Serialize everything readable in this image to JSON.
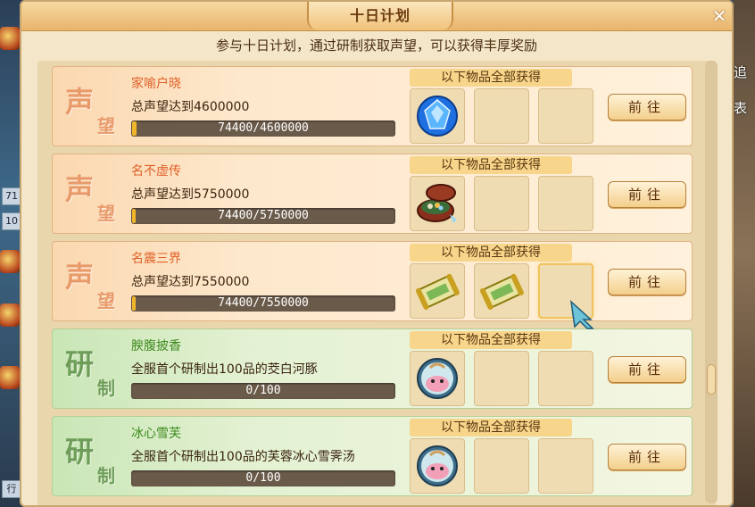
{
  "window": {
    "title": "十日计划",
    "close_glyph": "✕"
  },
  "subtitle": "参与十日计划，通过研制获取声望，可以获得丰厚奖励",
  "reward_header": "以下物品全部获得",
  "go_label": "前往",
  "background": {
    "left_chips": [
      "71",
      "10"
    ],
    "left_bottom": "行",
    "right_texts": [
      "追",
      "表"
    ]
  },
  "rows": [
    {
      "type": "fame",
      "badge": [
        "声",
        "望"
      ],
      "name": "家喻户晓",
      "desc": "总声望达到4600000",
      "progress_text": "74400/4600000",
      "progress": 0.0162,
      "rewards": [
        "blue-gem-icon",
        "",
        ""
      ]
    },
    {
      "type": "fame",
      "badge": [
        "声",
        "望"
      ],
      "name": "名不虚传",
      "desc": "总声望达到5750000",
      "progress_text": "74400/5750000",
      "progress": 0.0129,
      "rewards": [
        "treasure-box-icon",
        "",
        ""
      ]
    },
    {
      "type": "fame",
      "badge": [
        "声",
        "望"
      ],
      "name": "名震三界",
      "desc": "总声望达到7550000",
      "progress_text": "74400/7550000",
      "progress": 0.0099,
      "rewards": [
        "scroll-icon",
        "scroll-icon",
        ""
      ]
    },
    {
      "type": "craft",
      "badge": [
        "研",
        "制"
      ],
      "name": "腴腹披香",
      "desc": "全服首个研制出100品的茭白河豚",
      "progress_text": "0/100",
      "progress": 0,
      "rewards": [
        "food-bowl-icon",
        "",
        ""
      ]
    },
    {
      "type": "craft",
      "badge": [
        "研",
        "制"
      ],
      "name": "冰心雪芙",
      "desc": "全服首个研制出100品的芙蓉冰心雪霁汤",
      "progress_text": "0/100",
      "progress": 0,
      "rewards": [
        "food-bowl-icon",
        "",
        ""
      ]
    }
  ]
}
